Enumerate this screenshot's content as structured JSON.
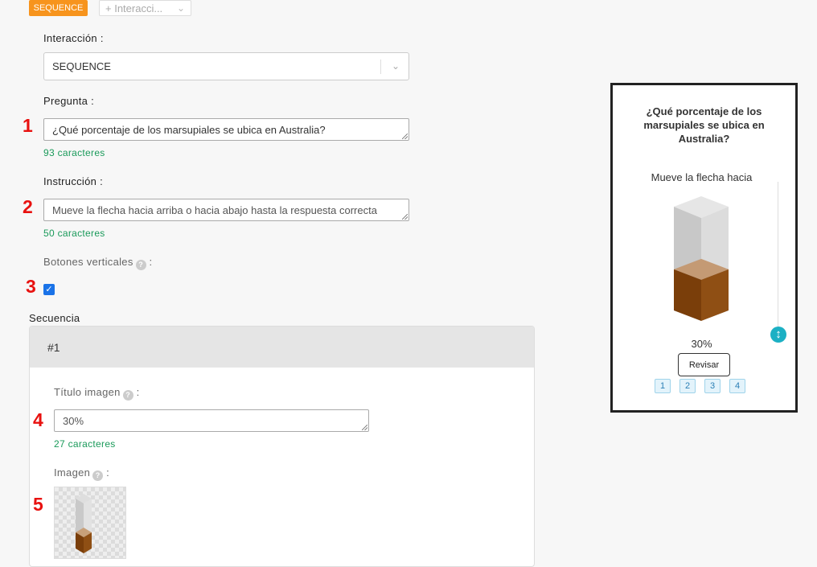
{
  "top_bar": {
    "tag": "SEQUENCE",
    "interaction_placeholder": "+ Interacci..."
  },
  "form": {
    "interaction": {
      "label": "Interacción",
      "value": "SEQUENCE"
    },
    "question": {
      "label": "Pregunta",
      "value": "¿Qué porcentaje de los marsupiales se ubica en Australia?",
      "counter": "93 caracteres"
    },
    "instruction": {
      "label": "Instrucción",
      "value": "Mueve la flecha hacia arriba o hacia abajo hasta la respuesta correcta",
      "counter": "50 caracteres"
    },
    "vertical_buttons": {
      "label": "Botones verticales",
      "checked": true
    },
    "sequence": {
      "label": "Secuencia",
      "item_header": "#1",
      "image_title": {
        "label": "Título imagen",
        "value": "30%",
        "counter": "27 caracteres"
      },
      "image": {
        "label": "Imagen"
      }
    }
  },
  "annotations": [
    "1",
    "2",
    "3",
    "4",
    "5"
  ],
  "preview": {
    "question": "¿Qué porcentaje de los marsupiales se ubica en Australia?",
    "instruction": "Mueve la flecha hacia",
    "value": "30%",
    "fill_fraction": 0.3,
    "check_button": "Revisar",
    "pages": [
      "1",
      "2",
      "3",
      "4"
    ]
  },
  "colors": {
    "tag": "#f7941d",
    "counter": "#1a9a5a",
    "annotation": "#e8110f",
    "checkbox": "#1a73e8",
    "handle": "#1cb0c4",
    "fill": "#8b4a12"
  },
  "icons": [
    "chevron-down-icon",
    "help-icon",
    "checkmark-icon",
    "up-down-arrow-icon"
  ]
}
